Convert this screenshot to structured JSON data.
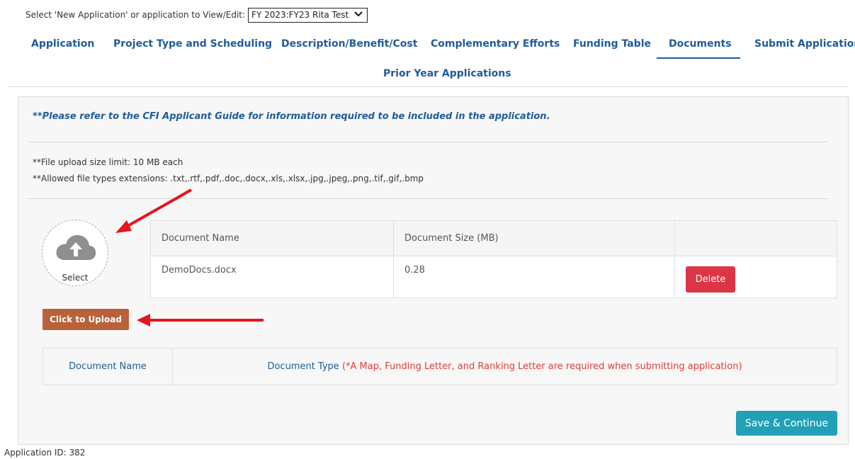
{
  "selector": {
    "label": "Select 'New Application' or application to View/Edit:",
    "value": "FY 2023:FY23 Rita Test"
  },
  "tabs": [
    {
      "label": "Application"
    },
    {
      "label": "Project Type and Scheduling"
    },
    {
      "label": "Description/Benefit/Cost"
    },
    {
      "label": "Complementary Efforts"
    },
    {
      "label": "Funding Table"
    },
    {
      "label": "Documents",
      "active": true
    },
    {
      "label": "Submit Application"
    },
    {
      "label": "Prior Year Applications"
    }
  ],
  "notice": "**Please refer to the CFI Applicant Guide for information required to be included in the application.",
  "info": {
    "size_limit": "**File upload size limit: 10 MB each",
    "allowed_types": "**Allowed file types extensions: .txt,.rtf,.pdf,.doc,.docx,.xls,.xlsx,.jpg,.jpeg,.png,.tif,.gif,.bmp"
  },
  "upload": {
    "select_label": "Select",
    "icon": "cloud-upload-icon",
    "button_label": "Click to Upload",
    "button_color": "#b8613a"
  },
  "documents_table": {
    "headers": [
      "Document Name",
      "Document Size (MB)",
      ""
    ],
    "rows": [
      {
        "name": "DemoDocs.docx",
        "size": "0.28",
        "action": "Delete"
      }
    ]
  },
  "types_table": {
    "col1": "Document Name",
    "col2_label": "Document Type",
    "col2_note": "(*A Map, Funding Letter, and Ranking Letter are required when submitting application)"
  },
  "save_button": "Save & Continue",
  "footer": {
    "application_id": "Application ID: 382"
  },
  "colors": {
    "link": "#1f5c99",
    "delete": "#dc3545",
    "save": "#22a0b5",
    "note": "#e03c3c",
    "annotation_arrow": "#e8141b"
  }
}
